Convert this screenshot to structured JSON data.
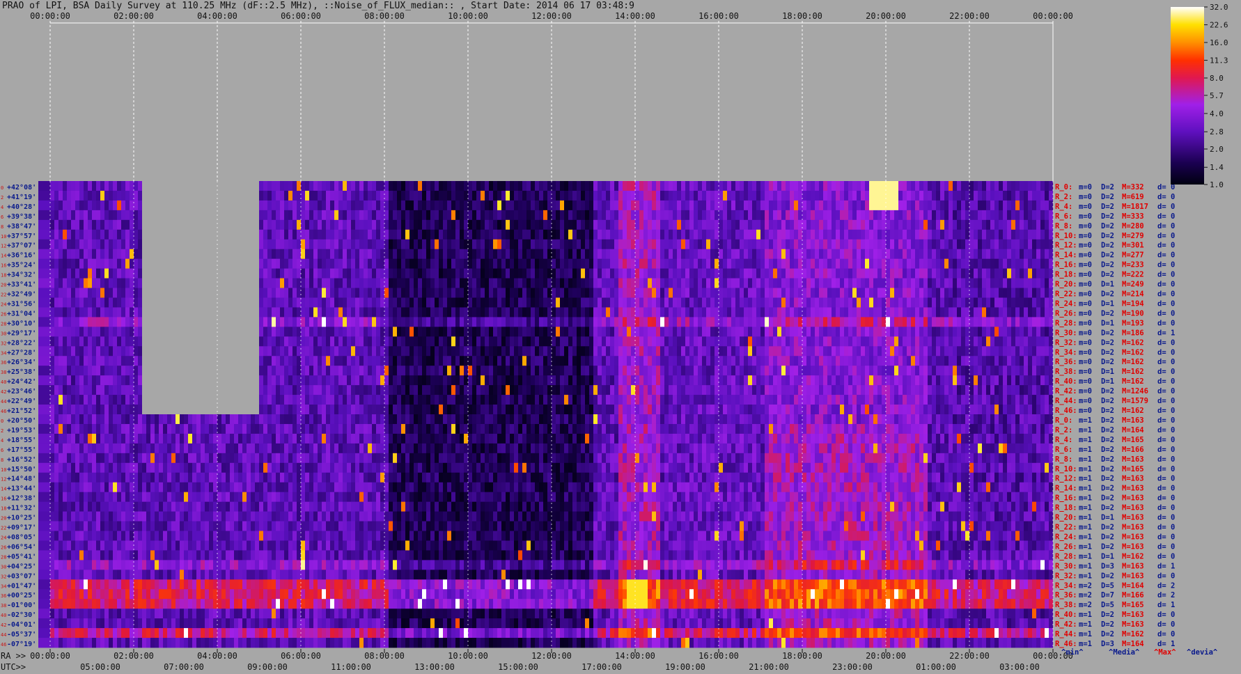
{
  "title": "PRAO of LPI, BSA Daily Survey at 110.25 MHz (dF::2.5 MHz), ::Noise_of_FLUX_median:: , Start Date: 2014 06 17 03:48:9",
  "chart_data": {
    "type": "heatmap",
    "title": "PRAO of LPI, BSA Daily Survey at 110.25 MHz (dF::2.5 MHz), ::Noise_of_FLUX_median:: , Start Date: 2014 06 17 03:48:9",
    "x_top_ticks": [
      "00:00:00",
      "02:00:00",
      "04:00:00",
      "06:00:00",
      "08:00:00",
      "10:00:00",
      "12:00:00",
      "14:00:00",
      "16:00:00",
      "18:00:00",
      "20:00:00",
      "22:00:00",
      "00:00:00"
    ],
    "ra_prefix": "RA >>",
    "ra_ticks": [
      "00:00:00",
      "02:00:00",
      "04:00:00",
      "06:00:00",
      "08:00:00",
      "10:00:00",
      "12:00:00",
      "14:00:00",
      "16:00:00",
      "18:00:00",
      "20:00:00",
      "22:00:00",
      "00:00:00"
    ],
    "utc_prefix": "UTC>>",
    "utc_ticks": [
      "05:00:00",
      "07:00:00",
      "09:00:00",
      "11:00:00",
      "13:00:00",
      "15:00:00",
      "17:00:00",
      "19:00:00",
      "21:00:00",
      "23:00:00",
      "01:00:00",
      "03:00:00"
    ],
    "dec_labels": [
      "+42°08'",
      "+41°19'",
      "+40°28'",
      "+39°38'",
      "+38°47'",
      "+37°57'",
      "+37°07'",
      "+36°16'",
      "+35°24'",
      "+34°32'",
      "+33°41'",
      "+32°49'",
      "+31°56'",
      "+31°04'",
      "+30°10'",
      "+29°17'",
      "+28°22'",
      "+27°28'",
      "+26°34'",
      "+25°38'",
      "+24°42'",
      "+23°46'",
      "+22°49'",
      "+21°52'",
      "+20°50'",
      "+19°53'",
      "+18°55'",
      "+17°55'",
      "+16°52'",
      "+15°50'",
      "+14°48'",
      "+13°44'",
      "+12°38'",
      "+11°32'",
      "+10°25'",
      "+09°17'",
      "+08°05'",
      "+06°54'",
      "+05°41'",
      "+04°25'",
      "+03°07'",
      "+01°47'",
      "+00°25'",
      "-01°00'",
      "-02°30'",
      "-04°01'",
      "-05°37'",
      "-07°19'"
    ],
    "beam_labels": [
      "0",
      "2",
      "4",
      "6",
      "8",
      "10",
      "12",
      "14",
      "16",
      "18",
      "20",
      "22",
      "24",
      "26",
      "28",
      "30",
      "32",
      "34",
      "36",
      "38",
      "40",
      "42",
      "44",
      "46",
      "0",
      "2",
      "4",
      "6",
      "8",
      "10",
      "12",
      "14",
      "16",
      "18",
      "20",
      "22",
      "24",
      "26",
      "28",
      "30",
      "32",
      "34",
      "36",
      "38",
      "40",
      "42",
      "44",
      "46"
    ],
    "stats_rows": [
      {
        "r": "R_0:",
        "m": "m=0",
        "d": "D=2",
        "M": "M=332",
        "dev": "d= 0"
      },
      {
        "r": "R_2:",
        "m": "m=0",
        "d": "D=2",
        "M": "M=619",
        "dev": "d= 0"
      },
      {
        "r": "R_4:",
        "m": "m=0",
        "d": "D=2",
        "M": "M=1817",
        "dev": "d= 0"
      },
      {
        "r": "R_6:",
        "m": "m=0",
        "d": "D=2",
        "M": "M=333",
        "dev": "d= 0"
      },
      {
        "r": "R_8:",
        "m": "m=0",
        "d": "D=2",
        "M": "M=280",
        "dev": "d= 0"
      },
      {
        "r": "R_10:",
        "m": "m=0",
        "d": "D=2",
        "M": "M=279",
        "dev": "d= 0"
      },
      {
        "r": "R_12:",
        "m": "m=0",
        "d": "D=2",
        "M": "M=301",
        "dev": "d= 0"
      },
      {
        "r": "R_14:",
        "m": "m=0",
        "d": "D=2",
        "M": "M=277",
        "dev": "d= 0"
      },
      {
        "r": "R_16:",
        "m": "m=0",
        "d": "D=2",
        "M": "M=233",
        "dev": "d= 0"
      },
      {
        "r": "R_18:",
        "m": "m=0",
        "d": "D=2",
        "M": "M=222",
        "dev": "d= 0"
      },
      {
        "r": "R_20:",
        "m": "m=0",
        "d": "D=1",
        "M": "M=249",
        "dev": "d= 0"
      },
      {
        "r": "R_22:",
        "m": "m=0",
        "d": "D=2",
        "M": "M=214",
        "dev": "d= 0"
      },
      {
        "r": "R_24:",
        "m": "m=0",
        "d": "D=1",
        "M": "M=194",
        "dev": "d= 0"
      },
      {
        "r": "R_26:",
        "m": "m=0",
        "d": "D=2",
        "M": "M=190",
        "dev": "d= 0"
      },
      {
        "r": "R_28:",
        "m": "m=0",
        "d": "D=1",
        "M": "M=193",
        "dev": "d= 0"
      },
      {
        "r": "R_30:",
        "m": "m=0",
        "d": "D=2",
        "M": "M=186",
        "dev": "d= 1"
      },
      {
        "r": "R_32:",
        "m": "m=0",
        "d": "D=2",
        "M": "M=162",
        "dev": "d= 0"
      },
      {
        "r": "R_34:",
        "m": "m=0",
        "d": "D=2",
        "M": "M=162",
        "dev": "d= 0"
      },
      {
        "r": "R_36:",
        "m": "m=0",
        "d": "D=2",
        "M": "M=162",
        "dev": "d= 0"
      },
      {
        "r": "R_38:",
        "m": "m=0",
        "d": "D=1",
        "M": "M=162",
        "dev": "d= 0"
      },
      {
        "r": "R_40:",
        "m": "m=0",
        "d": "D=1",
        "M": "M=162",
        "dev": "d= 0"
      },
      {
        "r": "R_42:",
        "m": "m=0",
        "d": "D=2",
        "M": "M=1246",
        "dev": "d= 0"
      },
      {
        "r": "R_44:",
        "m": "m=0",
        "d": "D=2",
        "M": "M=1579",
        "dev": "d= 0"
      },
      {
        "r": "R_46:",
        "m": "m=0",
        "d": "D=2",
        "M": "M=162",
        "dev": "d= 0"
      },
      {
        "r": "R_0:",
        "m": "m=1",
        "d": "D=2",
        "M": "M=163",
        "dev": "d= 0"
      },
      {
        "r": "R_2:",
        "m": "m=1",
        "d": "D=2",
        "M": "M=164",
        "dev": "d= 0"
      },
      {
        "r": "R_4:",
        "m": "m=1",
        "d": "D=2",
        "M": "M=165",
        "dev": "d= 0"
      },
      {
        "r": "R_6:",
        "m": "m=1",
        "d": "D=2",
        "M": "M=166",
        "dev": "d= 0"
      },
      {
        "r": "R_8:",
        "m": "m=1",
        "d": "D=2",
        "M": "M=163",
        "dev": "d= 0"
      },
      {
        "r": "R_10:",
        "m": "m=1",
        "d": "D=2",
        "M": "M=165",
        "dev": "d= 0"
      },
      {
        "r": "R_12:",
        "m": "m=1",
        "d": "D=2",
        "M": "M=163",
        "dev": "d= 0"
      },
      {
        "r": "R_14:",
        "m": "m=1",
        "d": "D=2",
        "M": "M=163",
        "dev": "d= 0"
      },
      {
        "r": "R_16:",
        "m": "m=1",
        "d": "D=2",
        "M": "M=163",
        "dev": "d= 0"
      },
      {
        "r": "R_18:",
        "m": "m=1",
        "d": "D=2",
        "M": "M=163",
        "dev": "d= 0"
      },
      {
        "r": "R_20:",
        "m": "m=1",
        "d": "D=1",
        "M": "M=163",
        "dev": "d= 0"
      },
      {
        "r": "R_22:",
        "m": "m=1",
        "d": "D=2",
        "M": "M=163",
        "dev": "d= 0"
      },
      {
        "r": "R_24:",
        "m": "m=1",
        "d": "D=2",
        "M": "M=163",
        "dev": "d= 0"
      },
      {
        "r": "R_26:",
        "m": "m=1",
        "d": "D=2",
        "M": "M=163",
        "dev": "d= 0"
      },
      {
        "r": "R_28:",
        "m": "m=1",
        "d": "D=1",
        "M": "M=162",
        "dev": "d= 0"
      },
      {
        "r": "R_30:",
        "m": "m=1",
        "d": "D=3",
        "M": "M=163",
        "dev": "d= 1"
      },
      {
        "r": "R_32:",
        "m": "m=1",
        "d": "D=2",
        "M": "M=163",
        "dev": "d= 0"
      },
      {
        "r": "R_34:",
        "m": "m=2",
        "d": "D=5",
        "M": "M=164",
        "dev": "d= 2"
      },
      {
        "r": "R_36:",
        "m": "m=2",
        "d": "D=7",
        "M": "M=166",
        "dev": "d= 2"
      },
      {
        "r": "R_38:",
        "m": "m=2",
        "d": "D=5",
        "M": "M=165",
        "dev": "d= 1"
      },
      {
        "r": "R_40:",
        "m": "m=1",
        "d": "D=2",
        "M": "M=163",
        "dev": "d= 0"
      },
      {
        "r": "R_42:",
        "m": "m=1",
        "d": "D=2",
        "M": "M=163",
        "dev": "d= 0"
      },
      {
        "r": "R_44:",
        "m": "m=1",
        "d": "D=2",
        "M": "M=162",
        "dev": "d= 0"
      },
      {
        "r": "R_46:",
        "m": "m=1",
        "d": "D=3",
        "M": "M=164",
        "dev": "d= 1"
      }
    ],
    "footer_legend": [
      "^min^",
      "^Media^",
      "^Max^",
      "^devia^"
    ],
    "colorbar_ticks": [
      "32.0",
      "22.6",
      "16.0",
      "11.3",
      "8.0",
      "5.7",
      "4.0",
      "2.8",
      "2.0",
      "1.4",
      "1.0"
    ],
    "colorbar_range": [
      1.0,
      32.0
    ],
    "colorbar_scale": "log",
    "palette": [
      "#000010",
      "#2a0060",
      "#7a10c8",
      "#b020e8",
      "#e8101a",
      "#ff6000",
      "#ffd000",
      "#ffffff"
    ],
    "colors": {
      "background": "#a7a7a7",
      "dec_label_blue": "#0a1a8c",
      "beam_label_red": "#c81414",
      "stats_red": "#e00000",
      "stats_blue": "#0a1a8c"
    },
    "hour_columns_bright": [
      14,
      19.5,
      20
    ],
    "empty_regions": [
      {
        "ra_from": 2.2,
        "ra_to": 5,
        "beams_missing": "upper 24 rows"
      }
    ]
  }
}
